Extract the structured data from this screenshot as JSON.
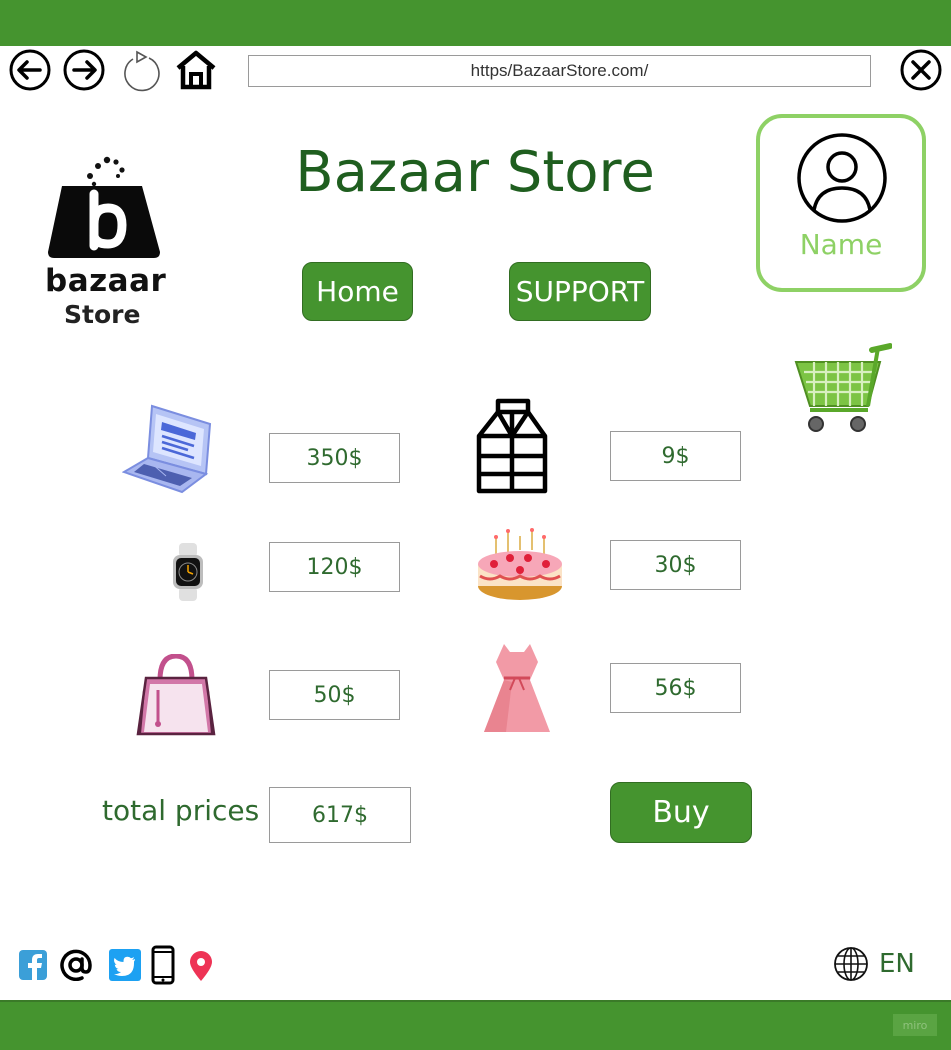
{
  "browser": {
    "url": "https/BazaarStore.com/"
  },
  "logo": {
    "word1": "bazaar",
    "word2": "Store"
  },
  "header": {
    "title": "Bazaar Store",
    "nav": {
      "home_label": "Home",
      "support_label": "SUPPORT"
    }
  },
  "profile": {
    "name": "Name"
  },
  "products": [
    {
      "icon": "laptop-icon",
      "price": "350$"
    },
    {
      "icon": "milk-carton-icon",
      "price": "9$"
    },
    {
      "icon": "smartwatch-icon",
      "price": "120$"
    },
    {
      "icon": "cake-icon",
      "price": "30$"
    },
    {
      "icon": "handbag-icon",
      "price": "50$"
    },
    {
      "icon": "dress-icon",
      "price": "56$"
    }
  ],
  "summary": {
    "total_label": "total prices",
    "total_value": "617$",
    "buy_label": "Buy"
  },
  "footer": {
    "language": "EN",
    "watermark": "miro"
  },
  "colors": {
    "brand_green": "#45942f",
    "text_green": "#1f5e1f",
    "profile_green": "#8ed165"
  }
}
